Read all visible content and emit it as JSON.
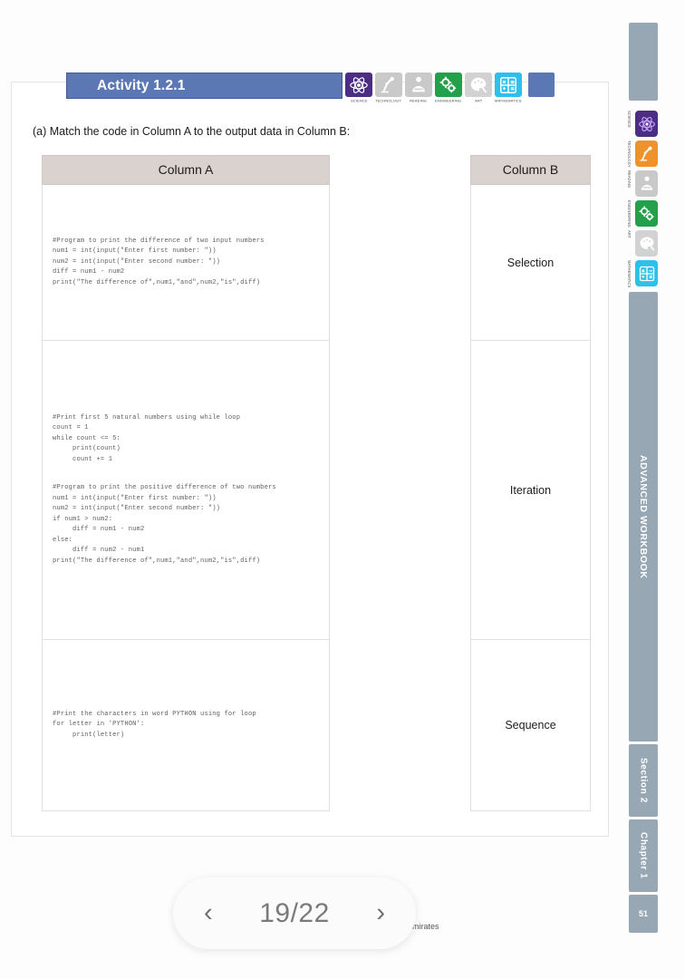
{
  "activity": {
    "title": "Activity 1.2.1"
  },
  "prompt": "(a) Match the code in Column A to the output data in Column B:",
  "stem_header": {
    "items": [
      {
        "caption": "SCIENCE",
        "icon": "atom-icon",
        "color": "#4b2e83"
      },
      {
        "caption": "TECHNOLOGY",
        "icon": "robot-arm-icon",
        "color": "#c9c9c9"
      },
      {
        "caption": "READING",
        "icon": "reader-icon",
        "color": "#c9c9c9"
      },
      {
        "caption": "ENGINEERING",
        "icon": "gears-icon",
        "color": "#22a04a"
      },
      {
        "caption": "ART",
        "icon": "palette-icon",
        "color": "#d2d2d2"
      },
      {
        "caption": "MATHEMATICS",
        "icon": "calculator-icon",
        "color": "#2ec0ea"
      }
    ]
  },
  "table": {
    "column_a": {
      "header": "Column A",
      "cells": [
        {
          "snippets": [
            "#Program to print the difference of two input numbers\nnum1 = int(input(\"Enter first number: \"))\nnum2 = int(input(\"Enter second number: \"))\ndiff = num1 - num2\nprint(\"The difference of\",num1,\"and\",num2,\"is\",diff)"
          ]
        },
        {
          "snippets": [
            "#Print first 5 natural numbers using while loop\ncount = 1\nwhile count <= 5:\n     print(count)\n     count += 1",
            "#Program to print the positive difference of two numbers\nnum1 = int(input(\"Enter first number: \"))\nnum2 = int(input(\"Enter second number: \"))\nif num1 > num2:\n     diff = num1 - num2\nelse:\n     diff = num2 - num1\nprint(\"The difference of\",num1,\"and\",num2,\"is\",diff)"
          ]
        },
        {
          "snippets": [
            "#Print the characters in word PYTHON using for loop\nfor letter in 'PYTHON':\n     print(letter)"
          ]
        }
      ]
    },
    "column_b": {
      "header": "Column B",
      "cells": [
        "Selection",
        "Iteration",
        "Sequence"
      ]
    }
  },
  "sidebar": {
    "stem_items": [
      {
        "caption": "SCIENCE",
        "icon": "atom-icon",
        "color": "#4b2e83"
      },
      {
        "caption": "TECHNOLOGY",
        "icon": "robot-arm-icon",
        "color": "#f0922b"
      },
      {
        "caption": "READING",
        "icon": "reader-icon",
        "color": "#c9c9c9"
      },
      {
        "caption": "ENGINEERING",
        "icon": "gears-icon",
        "color": "#22a04a"
      },
      {
        "caption": "ART",
        "icon": "palette-icon",
        "color": "#d2d2d2"
      },
      {
        "caption": "MATHEMATICS",
        "icon": "calculator-icon",
        "color": "#2ec0ea"
      }
    ],
    "workbook_label": "ADVANCED WORKBOOK",
    "section_label": "Section 2",
    "chapter_label": "Chapter 1",
    "page_number": "51"
  },
  "pagination": {
    "prev_icon": "chevron-left-icon",
    "next_icon": "chevron-right-icon",
    "count": "19/22"
  },
  "footer": {
    "text": "mirates"
  },
  "colors": {
    "banner_blue": "#5b78b5",
    "header_beige": "#d9d2cf",
    "sidebar_gray": "#98a7b4"
  }
}
